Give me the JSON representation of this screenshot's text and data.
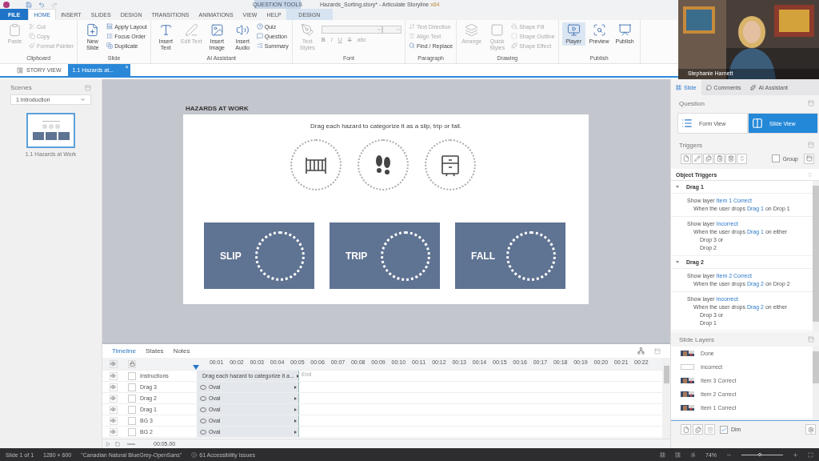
{
  "title_bar": {
    "title": "Hazards_Sorting.story* - Articulate Storyline",
    "arch": "x64",
    "context_label": "QUESTION TOOLS"
  },
  "ribbon_tabs": [
    {
      "label": "FILE",
      "kind": "file",
      "selected": false
    },
    {
      "label": "HOME",
      "kind": "tab",
      "selected": true
    },
    {
      "label": "INSERT",
      "kind": "tab",
      "selected": false
    },
    {
      "label": "SLIDES",
      "kind": "tab",
      "selected": false
    },
    {
      "label": "DESIGN",
      "kind": "tab",
      "selected": false
    },
    {
      "label": "TRANSITIONS",
      "kind": "tab",
      "selected": false
    },
    {
      "label": "ANIMATIONS",
      "kind": "tab",
      "selected": false
    },
    {
      "label": "VIEW",
      "kind": "tab",
      "selected": false
    },
    {
      "label": "HELP",
      "kind": "tab",
      "selected": false
    },
    {
      "label": "DESIGN",
      "kind": "context",
      "selected": false
    }
  ],
  "ribbon_groups": [
    {
      "label": "Clipboard",
      "items": [
        {
          "kind": "big",
          "label": "Paste",
          "disabled": true
        },
        {
          "kind": "small",
          "label": "Cut",
          "disabled": true
        },
        {
          "kind": "small",
          "label": "Copy",
          "disabled": true
        },
        {
          "kind": "small",
          "label": "Format Painter",
          "disabled": true
        }
      ]
    },
    {
      "label": "Slide",
      "items": [
        {
          "kind": "big",
          "label": "New Slide",
          "disabled": false
        },
        {
          "kind": "small",
          "label": "Apply Layout",
          "disabled": false
        },
        {
          "kind": "small",
          "label": "Focus Order",
          "disabled": false
        },
        {
          "kind": "small",
          "label": "Duplicate",
          "disabled": false
        }
      ]
    },
    {
      "label": "AI Assistant",
      "items": [
        {
          "kind": "big",
          "label": "Insert Text",
          "disabled": false
        },
        {
          "kind": "big",
          "label": "Edit Text",
          "disabled": true
        },
        {
          "kind": "big",
          "label": "Insert Image",
          "disabled": false
        },
        {
          "kind": "big",
          "label": "Insert Audio",
          "disabled": false
        },
        {
          "kind": "small",
          "label": "Quiz",
          "disabled": false
        },
        {
          "kind": "small",
          "label": "Question",
          "disabled": false
        },
        {
          "kind": "small",
          "label": "Summary",
          "disabled": false
        }
      ]
    },
    {
      "label": "Font",
      "items": [
        {
          "kind": "big",
          "label": "Text Styles",
          "disabled": true
        },
        {
          "kind": "format",
          "label": "B",
          "disabled": true
        },
        {
          "kind": "format",
          "label": "I",
          "disabled": true
        },
        {
          "kind": "format",
          "label": "U",
          "disabled": true
        },
        {
          "kind": "format",
          "label": "S",
          "disabled": true
        },
        {
          "kind": "format",
          "label": "abc",
          "disabled": true
        }
      ]
    },
    {
      "label": "Paragraph",
      "items": [
        {
          "kind": "small",
          "label": "Text Direction",
          "disabled": true
        },
        {
          "kind": "small",
          "label": "Align Text",
          "disabled": true
        },
        {
          "kind": "small",
          "label": "Find / Replace",
          "disabled": false
        }
      ]
    },
    {
      "label": "Drawing",
      "items": [
        {
          "kind": "big",
          "label": "Arrange",
          "disabled": true
        },
        {
          "kind": "big",
          "label": "Quick Styles",
          "disabled": true
        },
        {
          "kind": "small",
          "label": "Shape Fill",
          "disabled": true
        },
        {
          "kind": "small",
          "label": "Shape Outline",
          "disabled": true
        },
        {
          "kind": "small",
          "label": "Shape Effect",
          "disabled": true
        }
      ]
    },
    {
      "label": "Publish",
      "items": [
        {
          "kind": "big",
          "label": "Player",
          "disabled": false,
          "highlighted": true
        },
        {
          "kind": "big",
          "label": "Preview",
          "disabled": false,
          "highlighted": false
        },
        {
          "kind": "big",
          "label": "Publish",
          "disabled": false,
          "highlighted": false
        }
      ]
    }
  ],
  "webcam": {
    "name": "Stephanie Harnett"
  },
  "doc_tabs": [
    {
      "label": "STORY VIEW",
      "selected": false
    },
    {
      "label": "1.1 Hazards at...",
      "selected": true,
      "close": "×"
    }
  ],
  "scenes": {
    "title": "Scenes",
    "scene": "1 Introduction",
    "slides": [
      {
        "label": "1.1 Hazards at Work",
        "selected": true
      }
    ]
  },
  "slide": {
    "title": "HAZARDS AT WORK",
    "instruction": "Drag each hazard to categorize it as a slip, trip or fall.",
    "drop_targets": [
      "SLIP",
      "TRIP",
      "FALL"
    ]
  },
  "timeline": {
    "tabs": [
      {
        "label": "Timeline",
        "selected": true
      },
      {
        "label": "States",
        "selected": false
      },
      {
        "label": "Notes",
        "selected": false
      }
    ],
    "ticks": [
      "00:01",
      "00:02",
      "00:03",
      "00:04",
      "00:05",
      "00:06",
      "00:07",
      "00:08",
      "00:09",
      "00:10",
      "00:11",
      "00:12",
      "00:13",
      "00:14",
      "00:15",
      "00:16",
      "00:17",
      "00:18",
      "00:19",
      "00:20",
      "00:21",
      "00:22"
    ],
    "end_label": "End",
    "rows": [
      {
        "name": "Instructions",
        "kind": "text",
        "bar": "Drag each hazard to categorize it a...",
        "visible": true,
        "locked": false
      },
      {
        "name": "Drag 3",
        "kind": "oval",
        "bar": "Oval",
        "visible": true,
        "locked": false
      },
      {
        "name": "Drag 2",
        "kind": "oval",
        "bar": "Oval",
        "visible": true,
        "locked": false
      },
      {
        "name": "Drag 1",
        "kind": "oval",
        "bar": "Oval",
        "visible": true,
        "locked": false
      },
      {
        "name": "BG 3",
        "kind": "oval",
        "bar": "Oval",
        "visible": true,
        "locked": false
      },
      {
        "name": "BG 2",
        "kind": "oval",
        "bar": "Oval",
        "visible": true,
        "locked": false
      }
    ],
    "duration": "00:05.00"
  },
  "right_panel": {
    "tabs": [
      {
        "label": "Slide",
        "selected": true
      },
      {
        "label": "Comments",
        "selected": false
      },
      {
        "label": "AI Assistant",
        "selected": false
      }
    ],
    "question": {
      "title": "Question",
      "views": [
        {
          "label": "Form View",
          "selected": false
        },
        {
          "label": "Slide View",
          "selected": true
        }
      ]
    },
    "triggers": {
      "title": "Triggers",
      "group_label": "Group",
      "group_checked": false,
      "section": "Object Triggers",
      "objects": [
        {
          "name": "Drag 1",
          "expanded": true,
          "triggers": [
            {
              "action": "Show layer",
              "target": "Item 1 Correct",
              "when": "When the user drops",
              "object": "Drag 1",
              "rest": "on Drop 1"
            },
            {
              "action": "Show layer",
              "target": "Incorrect",
              "when": "When the user drops",
              "object": "Drag 1",
              "rest": "on either",
              "extra": [
                "Drop 3 or",
                "Drop 2"
              ]
            }
          ]
        },
        {
          "name": "Drag 2",
          "expanded": true,
          "triggers": [
            {
              "action": "Show layer",
              "target": "Item 2 Correct",
              "when": "When the user drops",
              "object": "Drag 2",
              "rest": "on Drop 2"
            },
            {
              "action": "Show layer",
              "target": "Incorrect",
              "when": "When the user drops",
              "object": "Drag 2",
              "rest": "on either",
              "extra": [
                "Drop 3 or",
                "Drop 1"
              ]
            }
          ]
        }
      ]
    },
    "layers": {
      "title": "Slide Layers",
      "items": [
        {
          "name": "Done",
          "kind": "picture"
        },
        {
          "name": "Incorrect",
          "kind": "blank"
        },
        {
          "name": "Item 3 Correct",
          "kind": "picture"
        },
        {
          "name": "Item 2 Correct",
          "kind": "picture"
        },
        {
          "name": "Item 1 Correct",
          "kind": "picture"
        }
      ],
      "dim_label": "Dim",
      "dim_checked": true
    }
  },
  "status_bar": {
    "items": [
      "Slide 1 of 1",
      "1280 × 600",
      "\"Canadian Natural BlueGrey-OpenSans\""
    ],
    "issues": "61 Accessibility Issues",
    "zoom": {
      "reading": "74%",
      "level": 0.45
    }
  }
}
